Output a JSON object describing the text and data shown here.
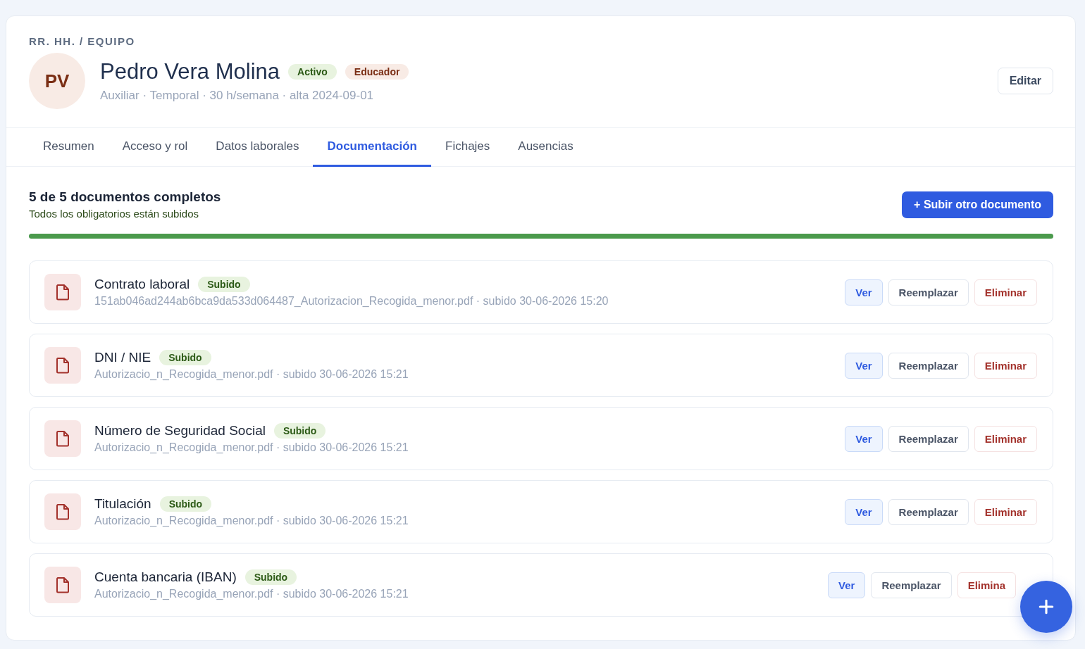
{
  "breadcrumb": "RR. HH. / EQUIPO",
  "profile": {
    "initials": "PV",
    "name": "Pedro Vera Molina",
    "badges": [
      {
        "label": "Activo",
        "kind": "status"
      },
      {
        "label": "Educador",
        "kind": "role"
      }
    ],
    "meta": "Auxiliar · Temporal · 30 h/semana · alta 2024-09-01",
    "edit_button": "Editar"
  },
  "tabs": [
    {
      "label": "Resumen",
      "selected": false
    },
    {
      "label": "Acceso y rol",
      "selected": false
    },
    {
      "label": "Datos laborales",
      "selected": false
    },
    {
      "label": "Documentación",
      "selected": true
    },
    {
      "label": "Fichajes",
      "selected": false
    },
    {
      "label": "Ausencias",
      "selected": false
    }
  ],
  "summary": {
    "title": "5 de 5 documentos completos",
    "subtitle": "Todos los obligatorios están subidos",
    "upload_button": "+ Subir otro documento",
    "level": 1
  },
  "documents": [
    {
      "name": "Contrato laboral",
      "status": "Subido",
      "file": "151ab046ad244ab6bca9da533d064487_Autorizacion_Recogida_menor.pdf · subido 30-06-2026 15:20",
      "actions": [
        "Ver",
        "Reemplazar",
        "Eliminar"
      ]
    },
    {
      "name": "DNI / NIE",
      "status": "Subido",
      "file": "Autorizacio_n_Recogida_menor.pdf · subido 30-06-2026 15:21",
      "actions": [
        "Ver",
        "Reemplazar",
        "Eliminar"
      ]
    },
    {
      "name": "Número de Seguridad Social",
      "status": "Subido",
      "file": "Autorizacio_n_Recogida_menor.pdf · subido 30-06-2026 15:21",
      "actions": [
        "Ver",
        "Reemplazar",
        "Eliminar"
      ]
    },
    {
      "name": "Titulación",
      "status": "Subido",
      "file": "Autorizacio_n_Recogida_menor.pdf · subido 30-06-2026 15:21",
      "actions": [
        "Ver",
        "Reemplazar",
        "Eliminar"
      ]
    },
    {
      "name": "Cuenta bancaria (IBAN)",
      "status": "Subido",
      "file": "Autorizacio_n_Recogida_menor.pdf · subido 30-06-2026 15:21",
      "actions": [
        "Ver",
        "Reemplazar",
        "Elimina"
      ]
    }
  ]
}
